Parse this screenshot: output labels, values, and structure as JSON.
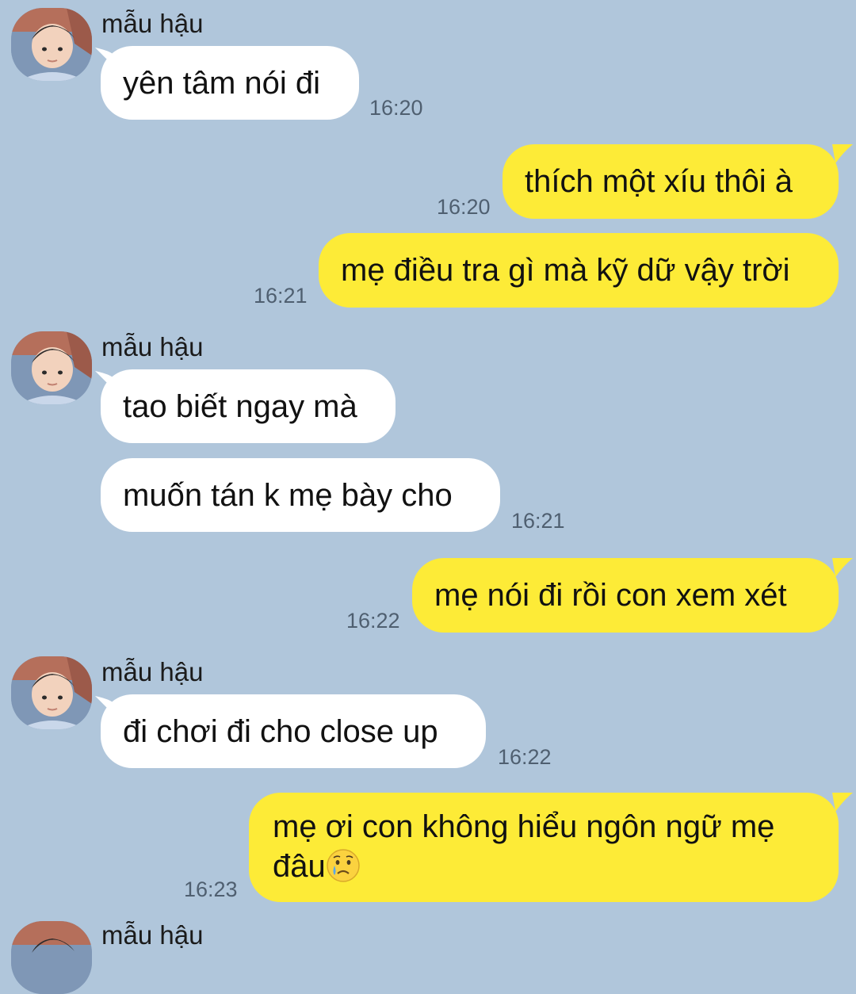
{
  "sender_name": "mẫu hậu",
  "messages": [
    {
      "text": "yên tâm nói đi",
      "time": "16:20"
    },
    {
      "text": "thích một xíu thôi à",
      "time": "16:20"
    },
    {
      "text": "mẹ điều tra gì mà kỹ dữ vậy trời",
      "time": "16:21"
    },
    {
      "text": "tao biết ngay mà"
    },
    {
      "text": "muốn tán k mẹ bày cho",
      "time": "16:21"
    },
    {
      "text": "mẹ nói đi rồi con xem xét",
      "time": "16:22"
    },
    {
      "text": "đi chơi đi cho close up",
      "time": "16:22"
    },
    {
      "text": "mẹ ơi con không hiểu ngôn ngữ mẹ đâu",
      "time": "16:23",
      "emoji": "crying-face-icon"
    }
  ],
  "colors": {
    "background": "#b0c6db",
    "incoming_bubble": "#ffffff",
    "outgoing_bubble": "#fdeb37"
  }
}
